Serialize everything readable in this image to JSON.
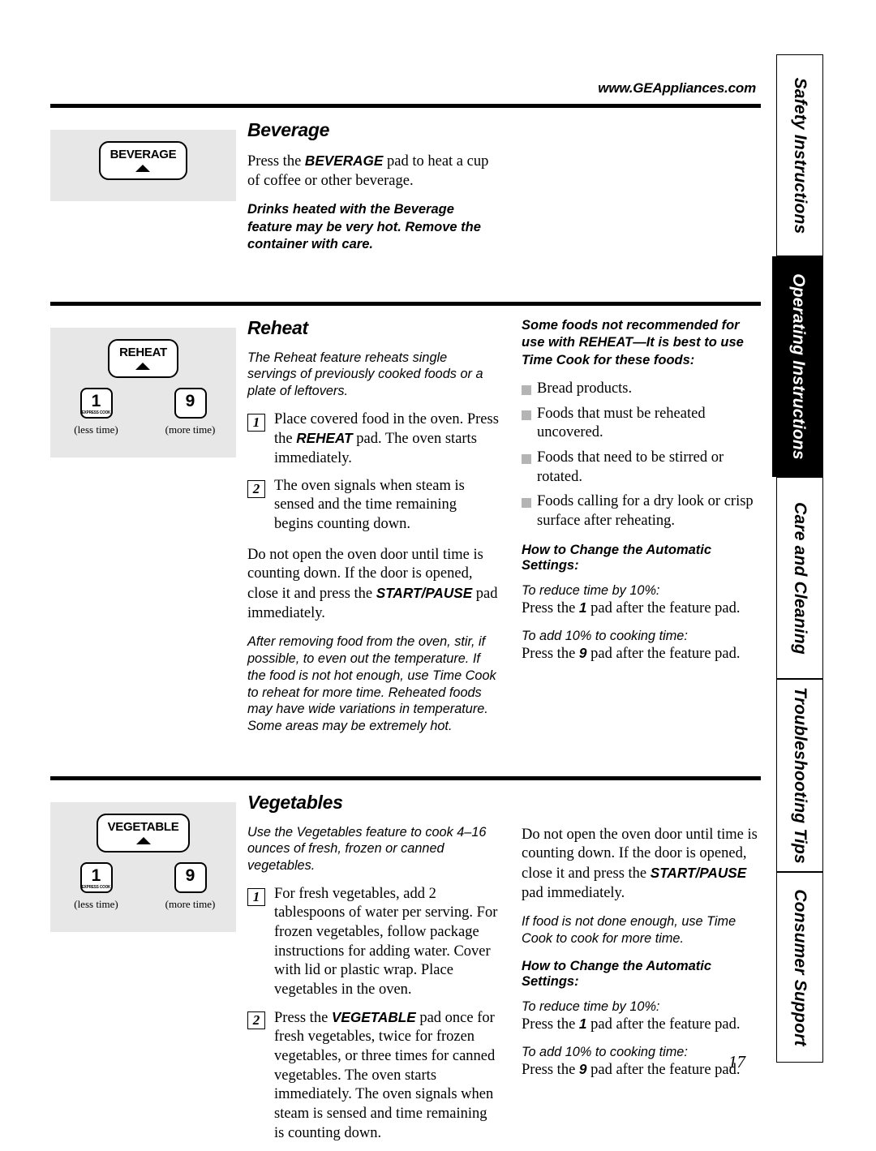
{
  "header": {
    "site_url": "www.GEAppliances.com"
  },
  "page_number": "17",
  "tabs": [
    {
      "label": "Safety Instructions",
      "active": false
    },
    {
      "label": "Operating Instructions",
      "active": true
    },
    {
      "label": "Care and Cleaning",
      "active": false
    },
    {
      "label": "Troubleshooting Tips",
      "active": false
    },
    {
      "label": "Consumer Support",
      "active": false
    }
  ],
  "sections": {
    "beverage": {
      "title": "Beverage",
      "pad": {
        "main_label": "BEVERAGE"
      },
      "intro_pre": "Press the ",
      "intro_bold": "BEVERAGE",
      "intro_post": " pad to heat a cup of coffee or other beverage.",
      "warning": "Drinks heated with the Beverage feature may be very hot. Remove the container with care."
    },
    "reheat": {
      "title": "Reheat",
      "pad": {
        "main_label": "REHEAT",
        "less_digit": "1",
        "less_sublabel": "EXPRESS COOK",
        "less_caption": "(less time)",
        "more_digit": "9",
        "more_caption": "(more time)"
      },
      "intro": "The Reheat feature reheats single servings of previously cooked foods or a plate of leftovers.",
      "steps": [
        {
          "num": "1",
          "pre": "Place covered food in the oven. Press the ",
          "bold": "REHEAT",
          "post": " pad. The oven starts immediately."
        },
        {
          "num": "2",
          "pre": "The oven signals when steam is sensed and the time remaining begins counting down.",
          "bold": "",
          "post": ""
        }
      ],
      "door_warning_pre": "Do not open the oven door until time is counting down. If the door is opened, close it and press the ",
      "door_warning_bold": "START/PAUSE",
      "door_warning_post": " pad immediately.",
      "note": "After removing food from the oven, stir, if possible, to even out the temperature. If the food is not hot enough, use Time Cook to reheat for more time. Reheated foods may have wide variations in temperature. Some areas may be extremely hot.",
      "not_recommended_head": "Some foods not recommended for use with REHEAT—It is best to use Time Cook for these foods:",
      "not_recommended_items": [
        "Bread products.",
        "Foods that must be reheated uncovered.",
        "Foods that need to be stirred or rotated.",
        "Foods calling for a dry look or crisp surface after reheating."
      ],
      "settings_head": "How to Change the Automatic Settings:",
      "settings": [
        {
          "label": "To reduce time by 10%:",
          "desc_pre": "Press the ",
          "desc_bold": "1",
          "desc_post": " pad after the feature pad."
        },
        {
          "label": "To add 10% to cooking time:",
          "desc_pre": "Press the ",
          "desc_bold": "9",
          "desc_post": " pad after the feature pad."
        }
      ]
    },
    "vegetables": {
      "title": "Vegetables",
      "pad": {
        "main_label": "VEGETABLE",
        "less_digit": "1",
        "less_sublabel": "EXPRESS COOK",
        "less_caption": "(less time)",
        "more_digit": "9",
        "more_caption": "(more time)"
      },
      "intro": "Use the Vegetables feature to cook 4–16 ounces of fresh, frozen or canned vegetables.",
      "steps": [
        {
          "num": "1",
          "pre": "For fresh vegetables, add 2 tablespoons of water per serving. For frozen vegetables, follow package instructions for adding water. Cover with lid or plastic wrap. Place vegetables in the oven.",
          "bold": "",
          "post": ""
        },
        {
          "num": "2",
          "pre": "Press the ",
          "bold": "VEGETABLE",
          "post": " pad once for fresh vegetables, twice for frozen vegetables, or three times for canned vegetables. The oven starts immediately. The oven signals when steam is sensed and time remaining is counting down."
        }
      ],
      "door_warning_pre": "Do not open the oven door until time is counting down. If the door is opened, close it and press the ",
      "door_warning_bold": "START/PAUSE",
      "door_warning_post": " pad immediately.",
      "note": "If food is not done enough, use Time Cook to cook for more time.",
      "settings_head": "How to Change the Automatic Settings:",
      "settings": [
        {
          "label": "To reduce time by 10%:",
          "desc_pre": "Press the ",
          "desc_bold": "1",
          "desc_post": " pad after the feature pad."
        },
        {
          "label": "To add 10% to cooking time:",
          "desc_pre": "Press the ",
          "desc_bold": "9",
          "desc_post": " pad after the feature pad."
        }
      ]
    }
  }
}
